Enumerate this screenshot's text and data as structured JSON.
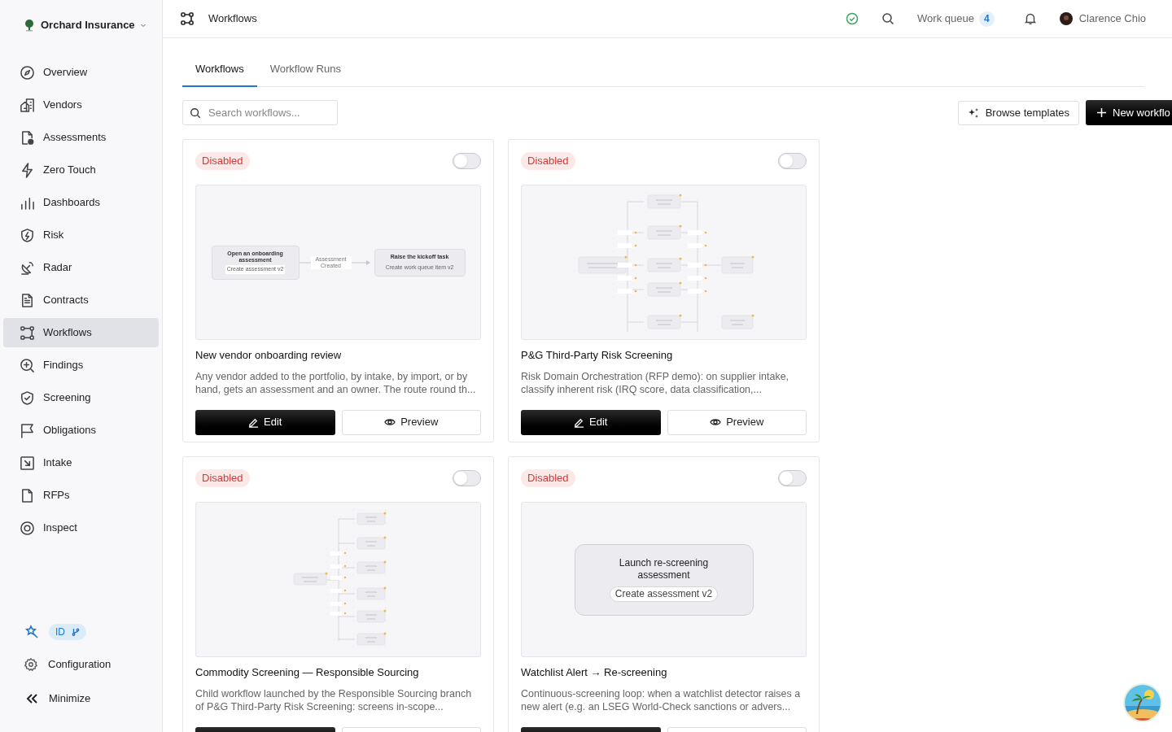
{
  "org": {
    "name": "Orchard Insurance"
  },
  "nav": [
    {
      "label": "Overview",
      "selected": false
    },
    {
      "label": "Vendors",
      "selected": false
    },
    {
      "label": "Assessments",
      "selected": false
    },
    {
      "label": "Zero Touch",
      "selected": false
    },
    {
      "label": "Dashboards",
      "selected": false
    },
    {
      "label": "Risk",
      "selected": false
    },
    {
      "label": "Radar",
      "selected": false
    },
    {
      "label": "Contracts",
      "selected": false
    },
    {
      "label": "Workflows",
      "selected": true
    },
    {
      "label": "Findings",
      "selected": false
    },
    {
      "label": "Screening",
      "selected": false
    },
    {
      "label": "Obligations",
      "selected": false
    },
    {
      "label": "Intake",
      "selected": false
    },
    {
      "label": "RFPs",
      "selected": false
    },
    {
      "label": "Inspect",
      "selected": false
    }
  ],
  "sidebar_footer": {
    "badge": "ID",
    "configuration": "Configuration",
    "minimize": "Minimize"
  },
  "header": {
    "title": "Workflows",
    "work_queue": {
      "label": "Work queue",
      "count": "4"
    },
    "user": "Clarence Chio"
  },
  "tabs": [
    {
      "label": "Workflows",
      "selected": true
    },
    {
      "label": "Workflow Runs",
      "selected": false
    }
  ],
  "search": {
    "placeholder": "Search workflows..."
  },
  "actions": {
    "browse": "Browse templates",
    "new": "New workflo"
  },
  "cards": [
    {
      "status": "Disabled",
      "enabled": false,
      "title": "New vendor onboarding review",
      "description": "Any vendor added to the portfolio, by intake, by import, or by hand, gets an assessment and an owner. The route round th...",
      "preview": {
        "kind": "flow",
        "nodes": [
          {
            "title": "Open an onboarding assessment",
            "subtitle": "Create assessment v2"
          },
          {
            "title": "Raise the kickoff task",
            "subtitle": "Create work queue item v2"
          }
        ],
        "edge_label": "Assessment Created"
      },
      "buttons": [
        {
          "kind": "primary",
          "label": "Edit"
        },
        {
          "kind": "secondary",
          "label": "Preview"
        }
      ]
    },
    {
      "status": "Disabled",
      "enabled": false,
      "title": "P&G Third-Party Risk Screening",
      "description": "Risk Domain Orchestration (RFP demo): on supplier intake, classify inherent risk (IRQ score, data classification,...",
      "preview": {
        "kind": "branching"
      },
      "buttons": [
        {
          "kind": "primary",
          "label": "Edit"
        },
        {
          "kind": "secondary",
          "label": "Preview"
        }
      ]
    },
    {
      "status": "Disabled",
      "enabled": false,
      "title": "Commodity Screening — Responsible Sourcing",
      "description": "Child workflow launched by the Responsible Sourcing branch of P&G Third-Party Risk Screening: screens in-scope...",
      "preview": {
        "kind": "fan"
      },
      "buttons": [
        {
          "kind": "primary"
        },
        {
          "kind": "secondary"
        }
      ]
    },
    {
      "status": "Disabled",
      "enabled": false,
      "title": "Watchlist Alert → Re-screening",
      "description": "Continuous-screening loop: when a watchlist detector raises a new alert (e.g. an LSEG World-Check sanctions or advers...",
      "preview": {
        "kind": "single",
        "nodes": [
          {
            "title": "Launch re-screening assessment",
            "subtitle": "Create assessment v2"
          }
        ]
      },
      "buttons": [
        {
          "kind": "primary"
        },
        {
          "kind": "secondary"
        }
      ]
    }
  ]
}
